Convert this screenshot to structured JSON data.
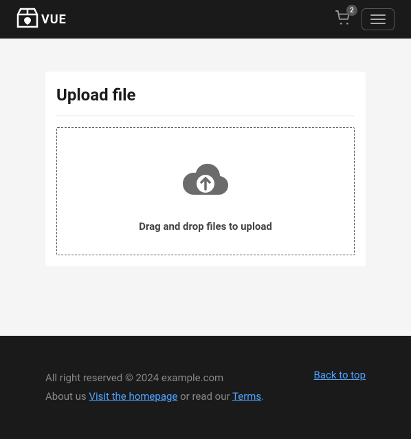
{
  "nav": {
    "brand": "VUE",
    "cart_count": "2"
  },
  "page": {
    "title": "Upload file",
    "dropzone_text": "Drag and drop files to upload"
  },
  "footer": {
    "copyright": "All right reserved © 2024 example.com",
    "about_prefix": "About us ",
    "homepage_link": "Visit the homepage",
    "read_prefix": " or read our ",
    "terms_link": "Terms",
    "period": ".",
    "back_to_top": "Back to top"
  }
}
